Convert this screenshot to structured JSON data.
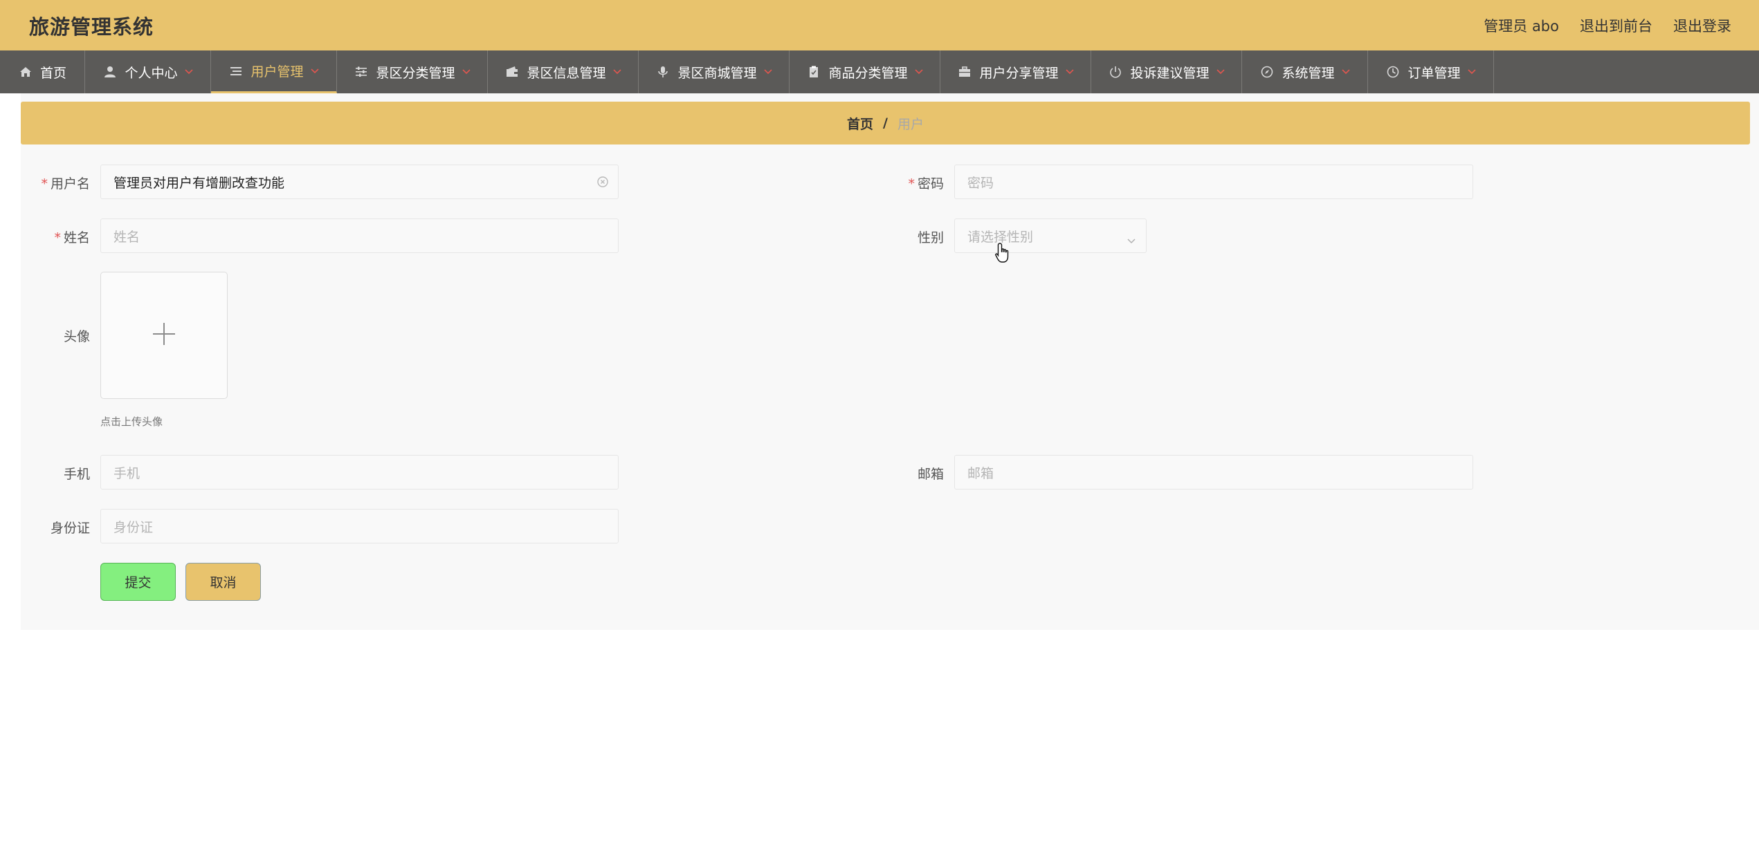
{
  "header": {
    "title": "旅游管理系统",
    "user_label": "管理员 abo",
    "frontend_link": "退出到前台",
    "logout_link": "退出登录"
  },
  "nav": {
    "items": [
      {
        "label": "首页",
        "icon": "home-icon"
      },
      {
        "label": "个人中心",
        "icon": "user-icon"
      },
      {
        "label": "用户管理",
        "icon": "list-icon",
        "active": true
      },
      {
        "label": "景区分类管理",
        "icon": "sliders-icon"
      },
      {
        "label": "景区信息管理",
        "icon": "wallet-icon"
      },
      {
        "label": "景区商城管理",
        "icon": "microphone-icon"
      },
      {
        "label": "商品分类管理",
        "icon": "clipboard-icon"
      },
      {
        "label": "用户分享管理",
        "icon": "briefcase-icon"
      },
      {
        "label": "投诉建议管理",
        "icon": "power-icon"
      },
      {
        "label": "系统管理",
        "icon": "compass-icon"
      },
      {
        "label": "订单管理",
        "icon": "clock-icon"
      }
    ]
  },
  "breadcrumb": {
    "home": "首页",
    "separator": "/",
    "current": "用户"
  },
  "form": {
    "username": {
      "label": "用户名",
      "required_mark": "*",
      "value": "管理员对用户有增删改查功能"
    },
    "password": {
      "label": "密码",
      "required_mark": "*",
      "placeholder": "密码"
    },
    "name": {
      "label": "姓名",
      "required_mark": "*",
      "placeholder": "姓名"
    },
    "gender": {
      "label": "性别",
      "placeholder": "请选择性别"
    },
    "avatar": {
      "label": "头像",
      "hint": "点击上传头像"
    },
    "phone": {
      "label": "手机",
      "placeholder": "手机"
    },
    "email": {
      "label": "邮箱",
      "placeholder": "邮箱"
    },
    "id_card": {
      "label": "身份证",
      "placeholder": "身份证"
    },
    "submit_label": "提交",
    "cancel_label": "取消"
  },
  "colors": {
    "header_bg": "#e8c36d",
    "nav_bg": "#5b5a58",
    "accent": "#e8c36d",
    "submit_bg": "#84ef7f",
    "required": "#e05252"
  }
}
